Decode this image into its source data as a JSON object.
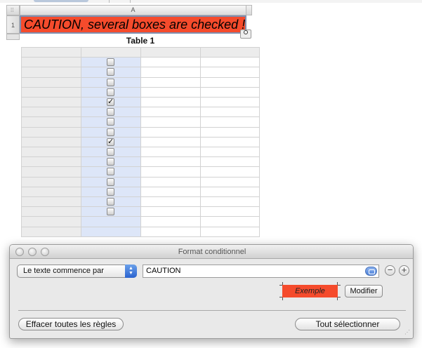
{
  "sheet": {
    "column_header": "A",
    "row_header": "1",
    "cell_a1_text": "CAUTION, several boxes are checked !",
    "cell_a1_color": "#f54b2c"
  },
  "table": {
    "title": "Table 1",
    "rows": 18,
    "columns": 4,
    "checkbox_column_color": "#dde6f8",
    "header_color": "#ececec",
    "checkboxes": [
      false,
      false,
      false,
      false,
      true,
      false,
      false,
      false,
      true,
      false,
      false,
      false,
      false,
      false,
      false,
      false
    ]
  },
  "dialog": {
    "title": "Format conditionnel",
    "rule_popup_label": "Le texte commence par",
    "rule_value": "CAUTION",
    "preview_label": "Exemple",
    "modify_label": "Modifier",
    "clear_all_label": "Effacer toutes les règles",
    "select_all_label": "Tout sélectionner",
    "remove_rule_symbol": "−",
    "add_rule_symbol": "+"
  }
}
